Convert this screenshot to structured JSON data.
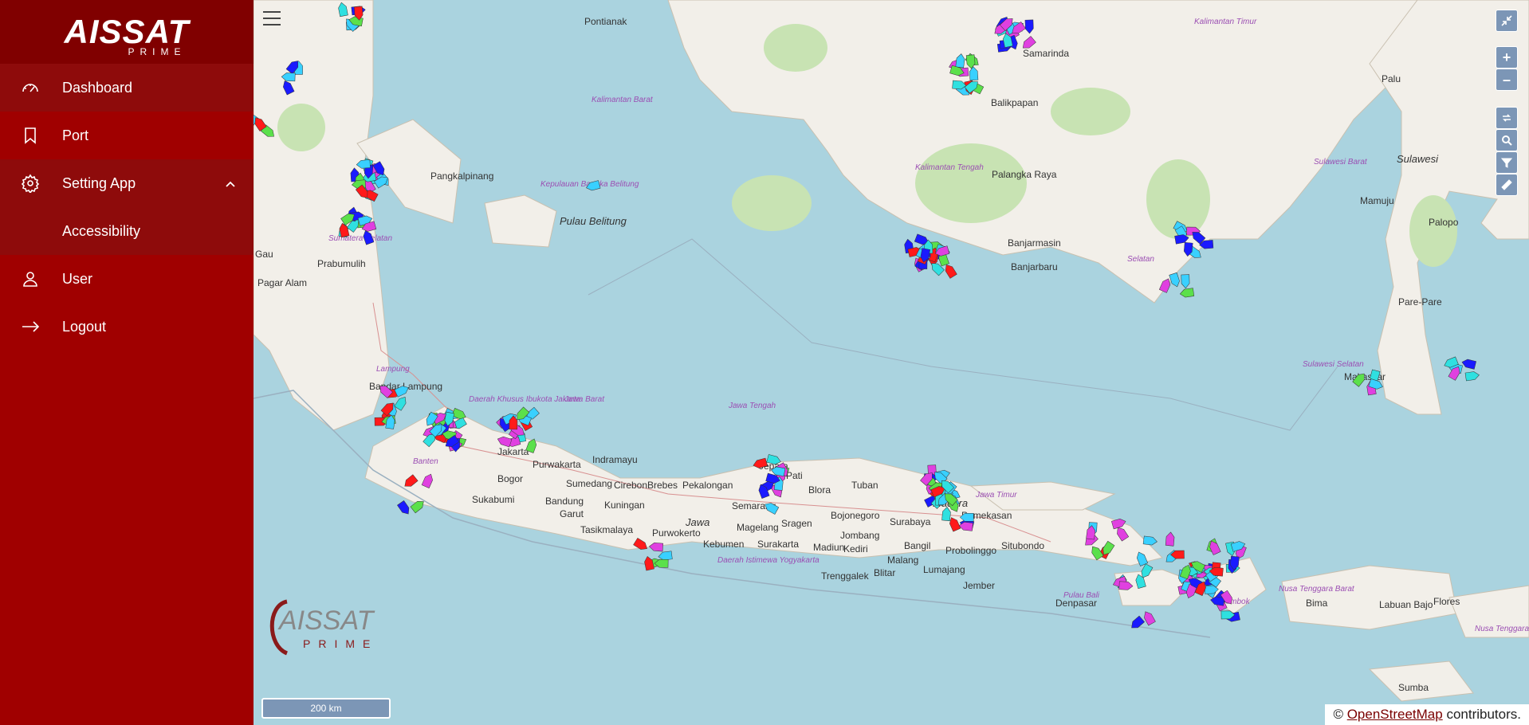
{
  "sidebar": {
    "logo": {
      "main": "AISSAT",
      "sub": "PRIME"
    },
    "items": [
      {
        "label": "Dashboard",
        "icon": "dashboard-icon",
        "active": true
      },
      {
        "label": "Port",
        "icon": "bookmark-icon",
        "active": false
      },
      {
        "label": "Setting App",
        "icon": "gear-icon",
        "expanded": true
      },
      {
        "label": "User",
        "icon": "user-icon",
        "active": false
      },
      {
        "label": "Logout",
        "icon": "arrow-right-icon",
        "active": false
      }
    ],
    "submenu": [
      {
        "label": "Accessibility"
      }
    ]
  },
  "map": {
    "scale_label": "200 km",
    "attribution": {
      "prefix": "©",
      "link": "OpenStreetMap",
      "suffix": "contributors."
    },
    "watermark": {
      "main": "AISSAT",
      "sub": "PRIME"
    },
    "controls": [
      "collapse-icon",
      "zoom-in-icon",
      "zoom-out-icon",
      "refresh-icon",
      "search-icon",
      "filter-icon",
      "ruler-icon"
    ],
    "labels": {
      "cities": [
        "Pontianak",
        "Pangkalpinang",
        "Palangka Raya",
        "Samarinda",
        "Balikpapan",
        "Palu",
        "Mamuju",
        "Palopo",
        "Pare-Pare",
        "Banjarmasin",
        "Banjarbaru",
        "Prabumulih",
        "Bandar Lampung",
        "Jakarta",
        "Bogor",
        "Sukabumi",
        "Bandung",
        "Tasikmalaya",
        "Purwakarta",
        "Sumedang",
        "Cirebon",
        "Brebes",
        "Pekalongan",
        "Indramayu",
        "Kuningan",
        "Garut",
        "Semarang",
        "Tuban",
        "Pamekasan",
        "Surabaya",
        "Bangil",
        "Malang",
        "Kediri",
        "Blitar",
        "Lumajang",
        "Jember",
        "Probolinggo",
        "Madiun",
        "Surakarta",
        "Sragen",
        "Magelang",
        "Kebumen",
        "Purwokerto",
        "Jombang",
        "Bojonegoro",
        "Trenggalek",
        "Denpasar",
        "Bima",
        "Labuan Bajo",
        "Sumba",
        "Pagar Alam",
        "Makassar",
        "Situbondo",
        "Flores",
        "Pati",
        "Jepara",
        "Blora",
        "Gau"
      ],
      "regions": [
        "Kalimantan Barat",
        "Kalimantan Tengah",
        "Kalimantan Timur",
        "Kepulauan Bangka Belitung",
        "Sumatera Selatan",
        "Lampung",
        "Daerah Khusus Ibukota Jakarta",
        "Jawa Barat",
        "Jawa Tengah",
        "Banten",
        "Daerah Istimewa Yogyakarta",
        "Jawa Timur",
        "Sulawesi Barat",
        "Sulawesi Selatan",
        "Nusa Tenggara Barat",
        "Nusa Tenggara Timur",
        "Selatan",
        "Pulau Bali",
        "Lombok"
      ],
      "islands": [
        "Sulawesi",
        "Jawa",
        "Madura",
        "Pulau Belitung"
      ]
    }
  }
}
